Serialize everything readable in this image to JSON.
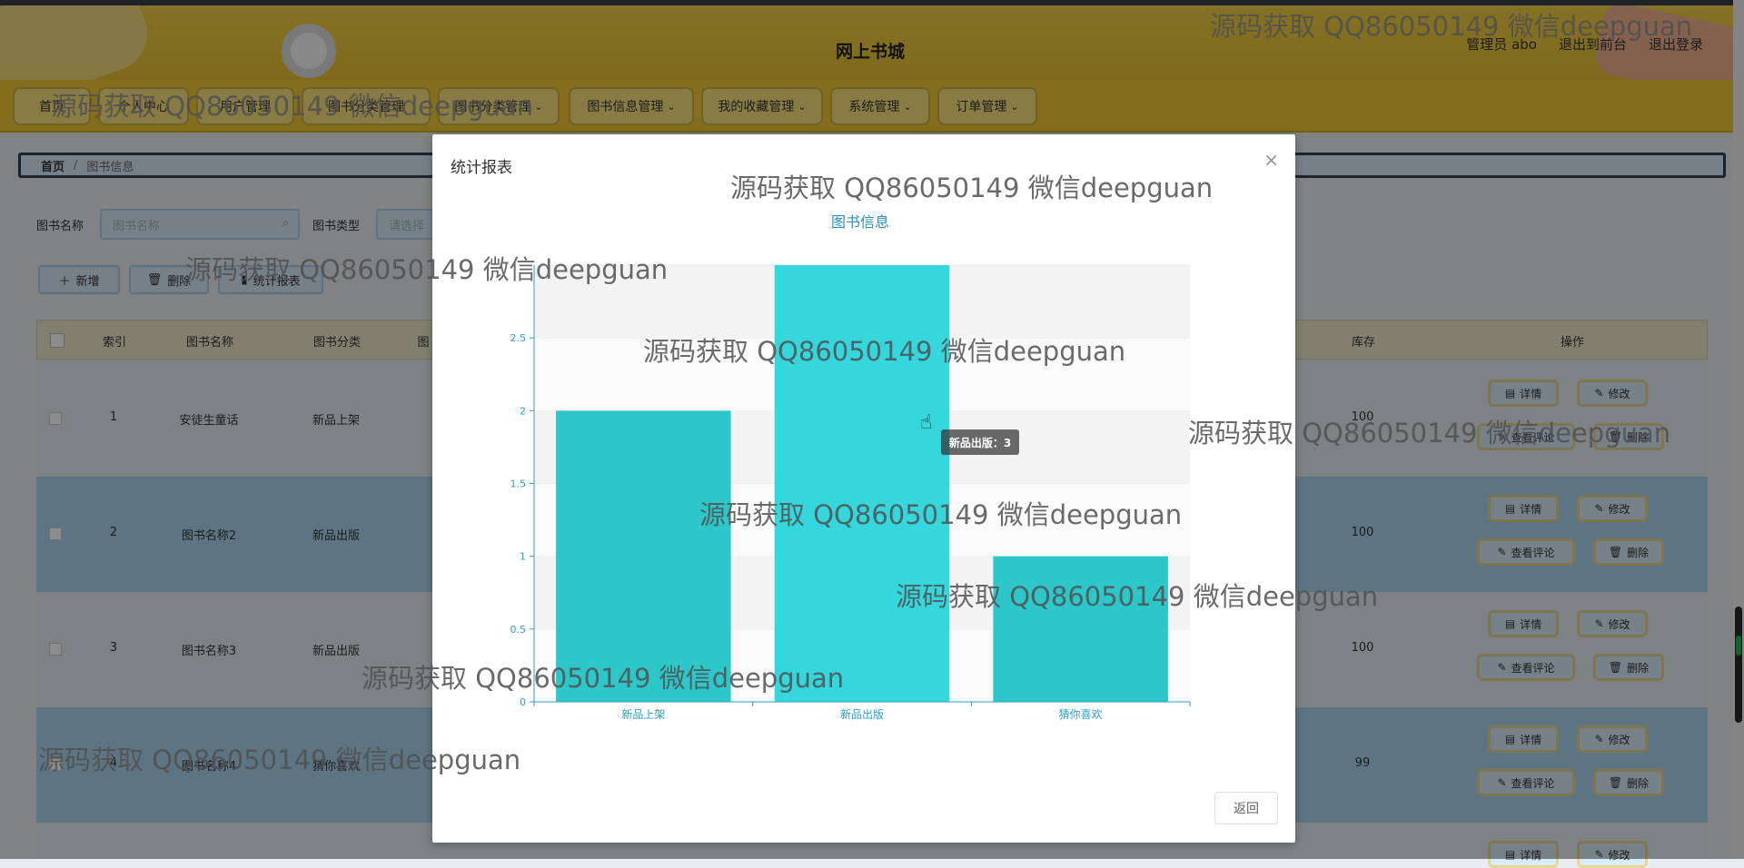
{
  "header": {
    "site_title": "网上书城",
    "links": [
      "管理员 abo",
      "退出到前台",
      "退出登录"
    ]
  },
  "nav": {
    "items": [
      {
        "label": "首页",
        "has_menu": false
      },
      {
        "label": "个人中心",
        "has_menu": false
      },
      {
        "label": "用户管理",
        "has_menu": false
      },
      {
        "label": "图书分类管理",
        "has_menu": false
      },
      {
        "label": "图书分类管理",
        "has_menu": true
      },
      {
        "label": "图书信息管理",
        "has_menu": true
      },
      {
        "label": "我的收藏管理",
        "has_menu": true
      },
      {
        "label": "系统管理",
        "has_menu": true
      },
      {
        "label": "订单管理",
        "has_menu": true
      }
    ]
  },
  "breadcrumb": {
    "home": "首页",
    "current": "图书信息"
  },
  "filters": {
    "name_label": "图书名称",
    "name_placeholder": "图书名称",
    "type_label": "图书类型",
    "type_placeholder": "请选择"
  },
  "actions": {
    "add": "新增",
    "delete": "删除",
    "report": "统计报表"
  },
  "table": {
    "headers": [
      "索引",
      "图书名称",
      "图书分类",
      "图",
      "库存",
      "操作"
    ],
    "rows": [
      {
        "index": "1",
        "name": "安徒生童话",
        "category": "新品上架",
        "stock": "100"
      },
      {
        "index": "2",
        "name": "图书名称2",
        "category": "新品出版",
        "stock": "100"
      },
      {
        "index": "3",
        "name": "图书名称3",
        "category": "新品出版",
        "stock": "100"
      },
      {
        "index": "4",
        "name": "图书名称4",
        "category": "猜你喜欢",
        "stock": "99"
      }
    ],
    "op_labels": {
      "detail": "详情",
      "edit": "修改",
      "comments": "查看评论",
      "delete": "删除"
    }
  },
  "modal": {
    "title": "统计报表",
    "return_label": "返回",
    "tooltip": "新品出版：3"
  },
  "chart_data": {
    "type": "bar",
    "title": "图书信息",
    "categories": [
      "新品上架",
      "新品出版",
      "猜你喜欢"
    ],
    "values": [
      2,
      3,
      1
    ],
    "yticks": [
      0,
      0.5,
      1,
      1.5,
      2,
      2.5
    ],
    "ylim": [
      0,
      3
    ],
    "grid": true,
    "colors": {
      "bar": "#2ec7c9",
      "bar_highlight": "#35d7dd",
      "axis": "#2ba0c8"
    }
  },
  "watermark_text": "源码获取 QQ86050149 微信deepguan"
}
